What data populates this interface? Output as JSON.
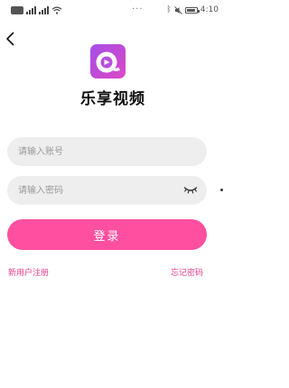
{
  "status_bar": {
    "time": "4:10",
    "overflow_dots": "···",
    "icons": [
      "sim-card-icon",
      "signal-icon",
      "signal-icon",
      "wifi-icon",
      "bluetooth-icon",
      "mute-icon",
      "battery-icon"
    ]
  },
  "header": {
    "back_icon": "chevron-left-icon"
  },
  "app": {
    "name": "乐享视频",
    "logo_colors": [
      "#a64fe8",
      "#dd4ac9"
    ]
  },
  "form": {
    "account_placeholder": "请输入账号",
    "account_value": "",
    "password_placeholder": "请输入密码",
    "password_value": "",
    "password_toggle_icon": "eye-closed-icon"
  },
  "actions": {
    "login_label": "登录",
    "register_label": "新用户注册",
    "forgot_label": "忘记密码"
  },
  "colors": {
    "accent": "#ff4fa0",
    "link": "#e8408e",
    "field_background": "#eeeeee"
  }
}
